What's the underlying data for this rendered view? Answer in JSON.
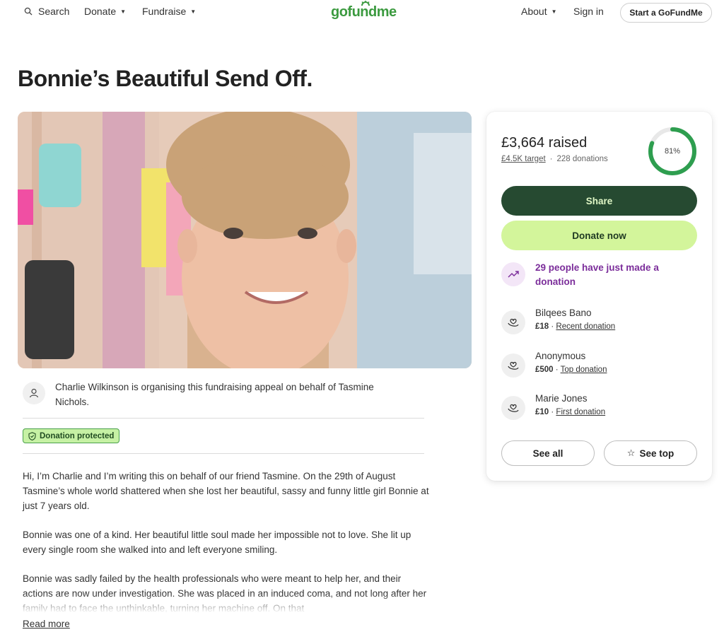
{
  "header": {
    "search_label": "Search",
    "donate_label": "Donate",
    "fundraise_label": "Fundraise",
    "logo_text": "gofundme",
    "about_label": "About",
    "signin_label": "Sign in",
    "start_label": "Start a GoFundMe"
  },
  "page_title": "Bonnie’s Beautiful Send Off.",
  "organiser": {
    "text": "Charlie Wilkinson is organising this fundraising appeal on behalf of Tasmine Nichols."
  },
  "protected_badge": "Donation protected",
  "story": {
    "p1": "Hi, I’m Charlie and I’m writing this on behalf of our friend Tasmine. On the 29th of August Tasmine’s whole world shattered when she lost her beautiful, sassy and funny little girl Bonnie at just 7 years old.",
    "p2": "Bonnie was one of a kind. Her beautiful little soul made her impossible not to love. She lit up every single room she walked into and left everyone smiling.",
    "p3": "Bonnie was sadly failed by the health professionals who were meant to help her, and their actions are now under investigation. She was placed in an induced coma, and not long after her family had to face the unthinkable, turning her machine off. On that",
    "read_more": "Read more"
  },
  "donation_card": {
    "raised": "£3,664 raised",
    "target": "£4.5K target",
    "separator": "·",
    "donations_count": "228 donations",
    "progress_percent": 81,
    "progress_label": "81%",
    "share_label": "Share",
    "donate_label": "Donate now",
    "trend_text": "29 people have just made a donation",
    "donors": [
      {
        "name": "Bilqees Bano",
        "amount": "£18",
        "tag": "Recent donation"
      },
      {
        "name": "Anonymous",
        "amount": "£500",
        "tag": "Top donation"
      },
      {
        "name": "Marie Jones",
        "amount": "£10",
        "tag": "First donation"
      }
    ],
    "see_all_label": "See all",
    "see_top_label": "See top"
  },
  "colors": {
    "brand_green": "#3b9a3f",
    "share_bg": "#264a31",
    "donate_bg": "#d3f59b",
    "trend_purple": "#7b2d9a",
    "progress_green": "#2e9e4f"
  }
}
